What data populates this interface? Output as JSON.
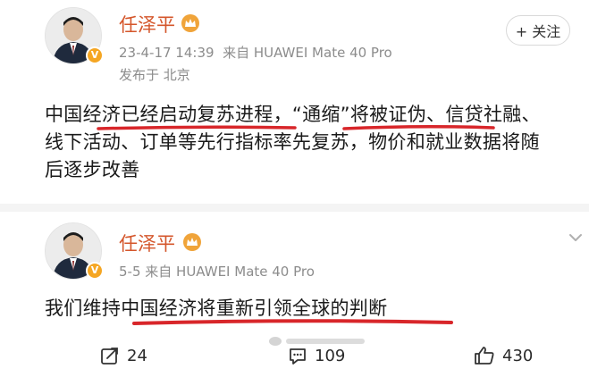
{
  "post1": {
    "author": "任泽平",
    "timestamp": "23-4-17 14:39",
    "source": "来自 HUAWEI Mate 40 Pro",
    "location": "发布于 北京",
    "follow_label": "+ 关注",
    "text": "中国经济已经启动复苏进程，“通缩”将被证伪、信贷社融、线下活动、订单等先行指标率先复苏，物价和就业数据将随后逐步改善"
  },
  "post2": {
    "author": "任泽平",
    "timestamp": "5-5",
    "source": "来自 HUAWEI Mate 40 Pro",
    "text": "我们维持中国经济将重新引领全球的判断"
  },
  "actions": {
    "reposts": "24",
    "comments": "109",
    "likes": "430"
  },
  "annotation_color": "#d8262a"
}
